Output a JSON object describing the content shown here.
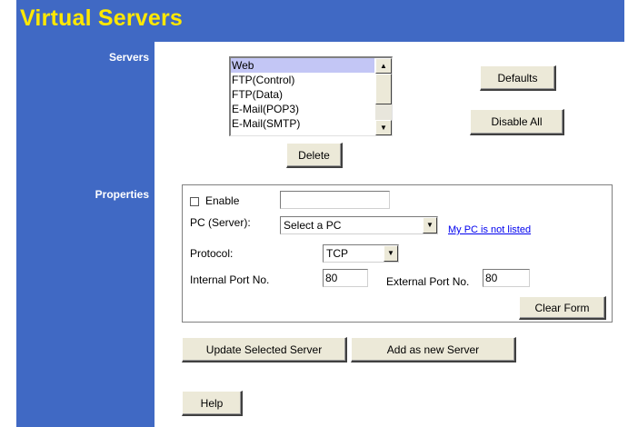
{
  "page_title": "Virtual Servers",
  "sidebar": {
    "servers_label": "Servers",
    "properties_label": "Properties"
  },
  "servers": {
    "items": [
      "Web",
      "FTP(Control)",
      "FTP(Data)",
      "E-Mail(POP3)",
      "E-Mail(SMTP)"
    ],
    "selected_index": 0,
    "defaults_label": "Defaults",
    "disable_all_label": "Disable All",
    "delete_label": "Delete"
  },
  "properties": {
    "enable_label": "Enable",
    "enable_checked": false,
    "name_value": "",
    "pc_label": "PC (Server):",
    "pc_value": "Select a PC",
    "pc_link": "My PC is not listed",
    "protocol_label": "Protocol:",
    "protocol_value": "TCP",
    "internal_port_label": "Internal Port No.",
    "internal_port_value": "80",
    "external_port_label": "External Port No.",
    "external_port_value": "80",
    "clear_form_label": "Clear Form"
  },
  "actions": {
    "update_label": "Update Selected Server",
    "add_label": "Add as new Server",
    "help_label": "Help"
  },
  "colors": {
    "header_bg": "#4069c4",
    "title_text": "#ffe800",
    "selection": "#c3c6f5"
  },
  "icons": {
    "scroll_up": "triangle-up",
    "scroll_down": "triangle-down",
    "dropdown": "triangle-down"
  }
}
